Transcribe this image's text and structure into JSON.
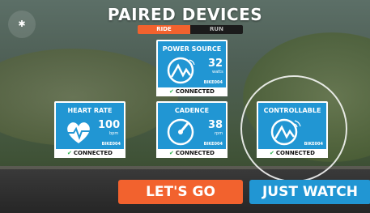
{
  "header": {
    "title": "PAIRED DEVICES",
    "tab_ride": "RIDE",
    "tab_run": "RUN"
  },
  "top_left_button": {
    "icon": "bluetooth-icon",
    "glyph": "✱"
  },
  "tiles": {
    "power": {
      "name": "POWER SOURCE",
      "value": "32",
      "unit": "watts",
      "device": "BIKE004",
      "status": "CONNECTED"
    },
    "heart": {
      "name": "HEART RATE",
      "value": "100",
      "unit": "bpm",
      "device": "BIKE004",
      "status": "CONNECTED"
    },
    "cadence": {
      "name": "CADENCE",
      "value": "38",
      "unit": "rpm",
      "device": "BIKE004",
      "status": "CONNECTED"
    },
    "controllable": {
      "name": "CONTROLLABLE",
      "device": "BIKE004",
      "status": "CONNECTED"
    }
  },
  "buttons": {
    "go": "LET'S GO",
    "watch": "JUST WATCH"
  },
  "colors": {
    "accent_orange": "#f2622e",
    "tile_blue": "#2196d3",
    "connected_green": "#2bb24c"
  }
}
